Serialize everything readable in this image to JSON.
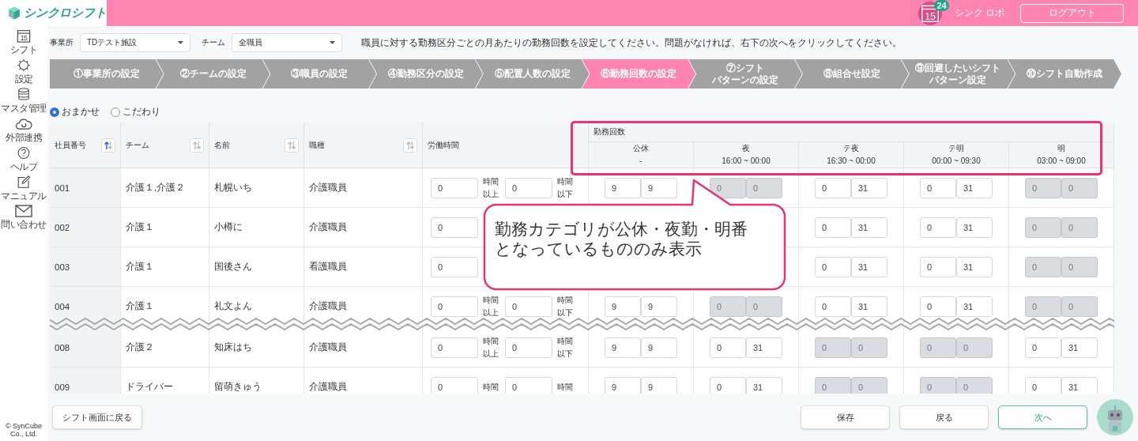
{
  "header": {
    "logo": "シンクロシフト",
    "calendar_date": "15",
    "badge": "24",
    "user": "シンク ロボ",
    "logout": "ログアウト"
  },
  "sidebar": {
    "items": [
      {
        "label": "シフト",
        "kind": "calendar",
        "date": "15"
      },
      {
        "label": "設定",
        "kind": "gear"
      },
      {
        "label": "マスタ管理",
        "kind": "database"
      },
      {
        "label": "外部連携",
        "kind": "cloud"
      },
      {
        "label": "ヘルプ",
        "kind": "help"
      },
      {
        "label": "マニュアル",
        "kind": "note"
      },
      {
        "label": "問い合わせ",
        "kind": "mail"
      }
    ],
    "copyright": "© SynCube Co., Ltd."
  },
  "filters": [
    {
      "label": "事業所",
      "value": "TDテスト施設"
    },
    {
      "label": "チーム",
      "value": "全職員"
    }
  ],
  "instruction": "職員に対する勤務区分ごとの月あたりの勤務回数を設定してください。問題がなければ、右下の次へをクリックしてください。",
  "steps": [
    {
      "lines": [
        "①事業所の設定"
      ],
      "selected": false
    },
    {
      "lines": [
        "②チームの設定"
      ],
      "selected": false
    },
    {
      "lines": [
        "③職員の設定"
      ],
      "selected": false
    },
    {
      "lines": [
        "④勤務区分の設定"
      ],
      "selected": false
    },
    {
      "lines": [
        "⑤配置人数の設定"
      ],
      "selected": false
    },
    {
      "lines": [
        "⑥勤務回数の設定"
      ],
      "selected": true
    },
    {
      "lines": [
        "⑦シフト",
        "パターンの設定"
      ],
      "selected": false
    },
    {
      "lines": [
        "⑧組合せ設定"
      ],
      "selected": false
    },
    {
      "lines": [
        "⑨回避したいシフト",
        "パターン設定"
      ],
      "selected": false
    },
    {
      "lines": [
        "⑩シフト自動作成"
      ],
      "selected": false
    }
  ],
  "mode_options": [
    {
      "label": "おまかせ",
      "selected": true
    },
    {
      "label": "こだわり",
      "selected": false
    }
  ],
  "table": {
    "columns": [
      {
        "label": "社員番号",
        "sorted": true
      },
      {
        "label": "チーム",
        "sorted": false
      },
      {
        "label": "名前",
        "sorted": false
      },
      {
        "label": "職種",
        "sorted": false
      },
      {
        "label": "労働時間"
      }
    ],
    "group_label": "勤務回数",
    "shift_columns": [
      {
        "name": "公休",
        "time": "-"
      },
      {
        "name": "夜",
        "time": "16:00 ~ 00:00"
      },
      {
        "name": "テ夜",
        "time": "16:30 ~ 00:00"
      },
      {
        "name": "テ明",
        "time": "00:00 ~ 09:30"
      },
      {
        "name": "明",
        "time": "03:00 ~ 09:00"
      }
    ],
    "row_groups": [
      {
        "rows": [
          {
            "id": "001",
            "team": "介護１,介護２",
            "name": "札幌いち",
            "job": "介護職員",
            "labor": {
              "min": "0",
              "min_label": "時間以上",
              "max": "0",
              "max_label": "時間以下"
            },
            "counts": [
              {
                "min": "9",
                "max": "9",
                "disabled": false
              },
              {
                "min": "0",
                "max": "0",
                "disabled": true
              },
              {
                "min": "0",
                "max": "31",
                "disabled": false
              },
              {
                "min": "0",
                "max": "31",
                "disabled": false
              },
              {
                "min": "0",
                "max": "0",
                "disabled": true
              }
            ]
          },
          {
            "id": "002",
            "team": "介護１",
            "name": "小樽に",
            "job": "介護職員",
            "labor": {
              "min": "0"
            },
            "counts": [
              {
                "min": "0",
                "max": "31",
                "disabled": false
              },
              {
                "min": "0",
                "max": "31",
                "disabled": false
              },
              {
                "min": "0",
                "max": "0",
                "disabled": true
              }
            ]
          },
          {
            "id": "003",
            "team": "介護１",
            "name": "国後さん",
            "job": "看護職員",
            "labor": {
              "min": "0"
            },
            "counts": [
              {
                "min": "0",
                "max": "31",
                "disabled": false
              },
              {
                "min": "0",
                "max": "31",
                "disabled": false
              },
              {
                "min": "0",
                "max": "0",
                "disabled": true
              }
            ]
          },
          {
            "id": "004",
            "team": "介護１",
            "name": "礼文よん",
            "job": "介護職員",
            "labor": {
              "min": "0",
              "min_label": "時間以上",
              "max": "0",
              "max_label": "時間以下"
            },
            "counts": [
              {
                "min": "9",
                "max": "9",
                "disabled": false
              },
              {
                "min": "0",
                "max": "0",
                "disabled": true
              },
              {
                "min": "0",
                "max": "31",
                "disabled": false
              },
              {
                "min": "0",
                "max": "31",
                "disabled": false
              },
              {
                "min": "0",
                "max": "0",
                "disabled": true
              }
            ]
          }
        ]
      },
      {
        "rows": [
          {
            "id": "008",
            "team": "介護２",
            "name": "知床はち",
            "job": "介護職員",
            "labor": {
              "min": "0",
              "min_label": "時間以上",
              "max": "0",
              "max_label": "時間以下"
            },
            "counts": [
              {
                "min": "9",
                "max": "9",
                "disabled": false
              },
              {
                "min": "0",
                "max": "31",
                "disabled": false
              },
              {
                "min": "0",
                "max": "0",
                "disabled": true
              },
              {
                "min": "0",
                "max": "0",
                "disabled": true
              },
              {
                "min": "0",
                "max": "31",
                "disabled": false
              }
            ]
          },
          {
            "id": "009",
            "team": "ドライバー",
            "name": "留萌きゅう",
            "job": "介護職員",
            "labor": {
              "min": "0",
              "min_label": "時間",
              "max": "0",
              "max_label": "時間"
            },
            "counts": [
              {
                "min": "9",
                "max": "9",
                "disabled": false
              },
              {
                "min": "0",
                "max": "31",
                "disabled": false
              },
              {
                "min": "0",
                "max": "0",
                "disabled": true
              },
              {
                "min": "0",
                "max": "0",
                "disabled": true
              },
              {
                "min": "0",
                "max": "31",
                "disabled": false
              }
            ]
          }
        ]
      }
    ]
  },
  "callout": {
    "lines": [
      "勤務カテゴリが公休・夜勤・明番",
      "となっているもののみ表示"
    ]
  },
  "footer": {
    "back": "シフト画面に戻る",
    "buttons": [
      {
        "label": "保存",
        "kind": "default"
      },
      {
        "label": "戻る",
        "kind": "default"
      },
      {
        "label": "次へ",
        "kind": "primary"
      }
    ]
  }
}
